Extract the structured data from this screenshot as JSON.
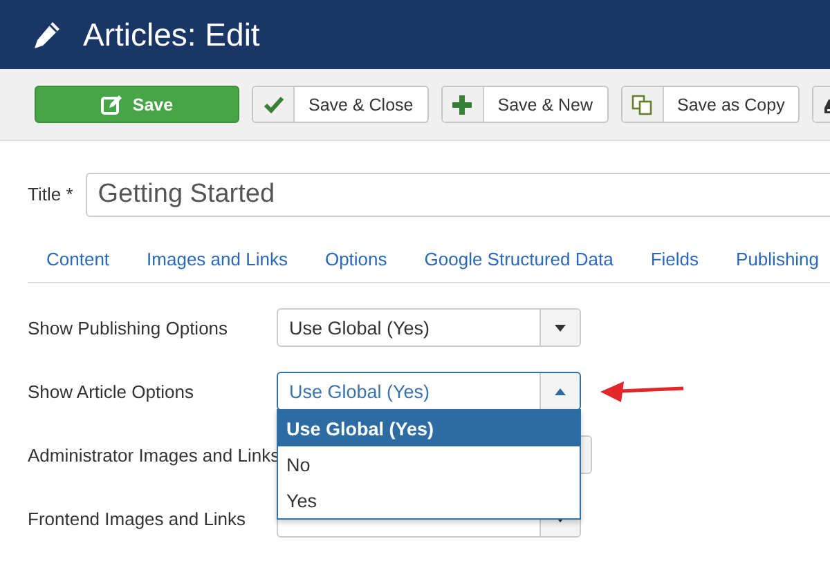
{
  "header": {
    "title": "Articles: Edit"
  },
  "toolbar": [
    {
      "kind": "primary",
      "label": "Save"
    },
    {
      "kind": "default",
      "label": "Save & Close"
    },
    {
      "kind": "default",
      "label": "Save & New"
    },
    {
      "kind": "default",
      "label": "Save as Copy"
    },
    {
      "kind": "icon-only"
    }
  ],
  "title_field": {
    "label": "Title *",
    "value": "Getting Started"
  },
  "tabs": [
    {
      "label": "Content",
      "selected": false
    },
    {
      "label": "Images and Links",
      "selected": false
    },
    {
      "label": "Options",
      "selected": false
    },
    {
      "label": "Google Structured Data",
      "selected": false
    },
    {
      "label": "Fields",
      "selected": false
    },
    {
      "label": "Publishing",
      "selected": false
    }
  ],
  "rows": [
    {
      "label": "Show Publishing Options",
      "value": "Use Global (Yes)",
      "open": false,
      "annotated": false
    },
    {
      "label": "Show Article Options",
      "value": "Use Global (Yes)",
      "open": true,
      "annotated": true,
      "options": [
        {
          "label": "Use Global (Yes)",
          "selected": true
        },
        {
          "label": "No",
          "selected": false
        },
        {
          "label": "Yes",
          "selected": false
        }
      ]
    },
    {
      "label": "Administrator Images and Links",
      "open": false,
      "annotated": false
    },
    {
      "label": "Frontend Images and Links",
      "open": false,
      "annotated": false
    }
  ]
}
